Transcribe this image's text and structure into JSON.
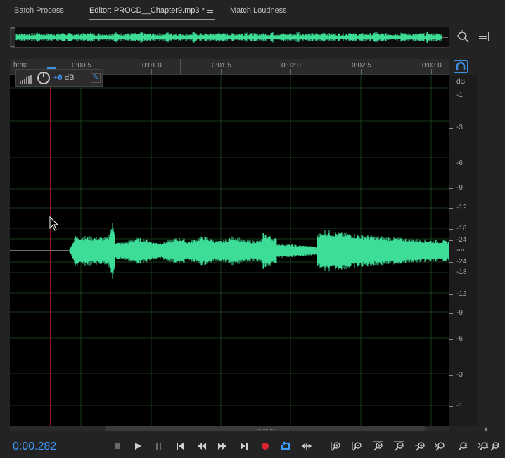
{
  "tabs": [
    {
      "label": "Batch Process",
      "active": false
    },
    {
      "label": "Editor: PROCD__Chapter9.mp3 *",
      "active": true
    },
    {
      "label": "Match Loudness",
      "active": false
    }
  ],
  "ruler": {
    "unit_label": "hms",
    "ticks": [
      "0:00.5",
      "0:01.0",
      "0:01.5",
      "0:02.0",
      "0:02.5",
      "0:03.0"
    ]
  },
  "hud": {
    "gain_value": "+0",
    "gain_unit": "dB"
  },
  "db_scale": {
    "unit_label": "dB",
    "labels": [
      "-1",
      "-3",
      "-6",
      "-9",
      "-12",
      "-18",
      "-24",
      "-∞",
      "-24",
      "-18",
      "-12",
      "-9",
      "-6",
      "-3",
      "-1"
    ]
  },
  "transport": {
    "time": "0:00.282"
  },
  "colors": {
    "waveform": "#3ddc97",
    "playhead": "#c0202a",
    "accent": "#3f9bff"
  },
  "icons": {
    "transport": [
      "stop-icon",
      "play-icon",
      "pause-icon",
      "go-to-start-icon",
      "rewind-icon",
      "fast-forward-icon",
      "go-to-end-icon",
      "record-icon",
      "loop-icon",
      "skip-selection-icon"
    ],
    "zoom": [
      "zoom-in-amplitude-icon",
      "zoom-out-amplitude-icon",
      "zoom-in-time-icon",
      "zoom-out-time-icon",
      "zoom-full-icon",
      "zoom-in-at-start-icon",
      "zoom-in-at-end-icon",
      "zoom-selection-icon",
      "zoom-out-full-icon"
    ]
  }
}
